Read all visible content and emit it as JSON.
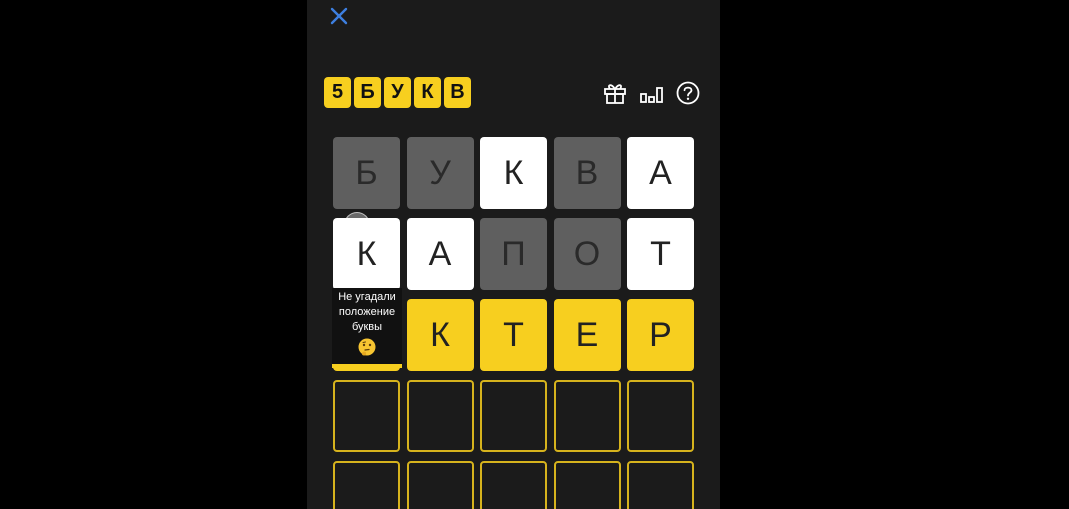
{
  "header": {
    "logo_letters": [
      "5",
      "Б",
      "У",
      "К",
      "В"
    ],
    "icons": [
      "close-icon",
      "gift-icon",
      "stats-icon",
      "help-icon"
    ]
  },
  "colors": {
    "background": "#1b1b1b",
    "accent_yellow": "#f7cf1f",
    "absent_gray": "#5f5f5f",
    "misplaced_white": "#ffffff",
    "close_blue": "#3d7fe0"
  },
  "board": {
    "rows": [
      {
        "word": "БУКВА",
        "tiles": [
          {
            "letter": "Б",
            "state": "absent"
          },
          {
            "letter": "У",
            "state": "absent"
          },
          {
            "letter": "К",
            "state": "misplaced"
          },
          {
            "letter": "В",
            "state": "absent"
          },
          {
            "letter": "А",
            "state": "misplaced"
          }
        ]
      },
      {
        "word": "КАПОТ",
        "tiles": [
          {
            "letter": "К",
            "state": "misplaced"
          },
          {
            "letter": "А",
            "state": "misplaced"
          },
          {
            "letter": "П",
            "state": "absent"
          },
          {
            "letter": "О",
            "state": "absent"
          },
          {
            "letter": "Т",
            "state": "misplaced"
          }
        ]
      },
      {
        "word": "?КТЕР",
        "tiles": [
          {
            "letter": "",
            "state": "correct"
          },
          {
            "letter": "К",
            "state": "correct"
          },
          {
            "letter": "Т",
            "state": "correct"
          },
          {
            "letter": "Е",
            "state": "correct"
          },
          {
            "letter": "Р",
            "state": "correct"
          }
        ]
      },
      {
        "word": "",
        "tiles": [
          {
            "letter": "",
            "state": "empty"
          },
          {
            "letter": "",
            "state": "empty"
          },
          {
            "letter": "",
            "state": "empty"
          },
          {
            "letter": "",
            "state": "empty"
          },
          {
            "letter": "",
            "state": "empty"
          }
        ]
      },
      {
        "word": "",
        "tiles": [
          {
            "letter": "",
            "state": "empty"
          },
          {
            "letter": "",
            "state": "empty"
          },
          {
            "letter": "",
            "state": "empty"
          },
          {
            "letter": "",
            "state": "empty"
          },
          {
            "letter": "",
            "state": "empty"
          }
        ]
      }
    ]
  },
  "tooltip": {
    "lines": [
      "Не угадали",
      "положение",
      "буквы"
    ],
    "emoji": "thinking-face-icon"
  }
}
